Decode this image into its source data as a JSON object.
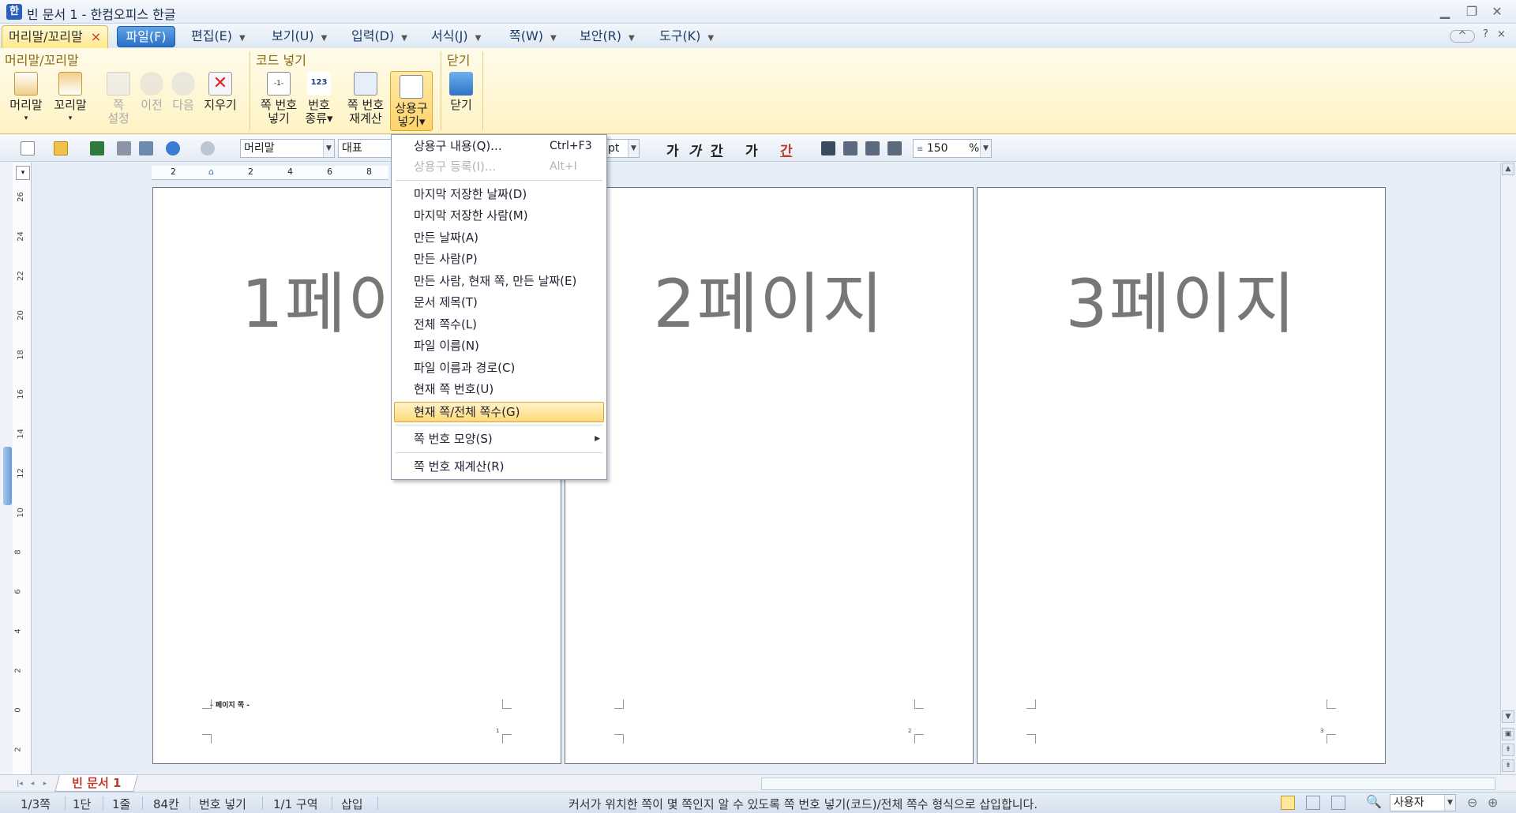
{
  "window": {
    "title": "빈 문서 1 - 한컴오피스 한글",
    "app_icon": "한"
  },
  "menubar": {
    "context_tab": "머리말/꼬리말",
    "context_close": "×",
    "file_tab": "파일(F)",
    "items": [
      "편집(E)",
      "보기(U)",
      "입력(D)",
      "서식(J)",
      "쪽(W)",
      "보안(R)",
      "도구(K)"
    ],
    "right": [
      "^",
      "?",
      "×"
    ]
  },
  "ribbon": {
    "groups": [
      {
        "label": "머리말/꼬리말"
      },
      {
        "label": "코드 넣기"
      },
      {
        "label": "닫기"
      }
    ],
    "buttons": [
      {
        "label": "머리말",
        "sub": "▾"
      },
      {
        "label": "꼬리말",
        "sub": "▾"
      },
      {
        "label": "쪽",
        "sub": "설정"
      },
      {
        "label": "이전"
      },
      {
        "label": "다음"
      },
      {
        "label": "지우기"
      },
      {
        "label": "쪽 번호",
        "sub": "넣기"
      },
      {
        "label": "번호",
        "sub": "종류▾"
      },
      {
        "label": "쪽 번호",
        "sub": "재계산"
      },
      {
        "label": "상용구",
        "sub": "넣기▾"
      },
      {
        "label": "닫기"
      }
    ]
  },
  "toolbar": {
    "style_combo": "머리말",
    "font_combo": "대표",
    "size_unit": "pt",
    "bold": "가",
    "italic": "가",
    "underline": "간",
    "strike": "가",
    "color": "간",
    "line_spacing": "150",
    "percent": "%"
  },
  "pages": [
    {
      "big_text": "1페이지",
      "footer_number": "1",
      "footer_code": "- 페이지 쪽 -"
    },
    {
      "big_text": "2페이지",
      "footer_number": "2"
    },
    {
      "big_text": "3페이지",
      "footer_number": "3"
    }
  ],
  "dropdown": {
    "items": [
      {
        "label": "상용구 내용(Q)...",
        "shortcut": "Ctrl+F3"
      },
      {
        "label": "상용구 등록(I)...",
        "shortcut": "Alt+I",
        "disabled": true
      },
      {
        "label": "마지막 저장한 날짜(D)"
      },
      {
        "label": "마지막 저장한 사람(M)"
      },
      {
        "label": "만든 날짜(A)"
      },
      {
        "label": "만든 사람(P)"
      },
      {
        "label": "만든 사람, 현재 쪽, 만든 날짜(E)"
      },
      {
        "label": "문서 제목(T)"
      },
      {
        "label": "전체 쪽수(L)"
      },
      {
        "label": "파일 이름(N)"
      },
      {
        "label": "파일 이름과 경로(C)"
      },
      {
        "label": "현재 쪽 번호(U)"
      },
      {
        "label": "현재 쪽/전체 쪽수(G)",
        "highlighted": true
      },
      {
        "label": "쪽 번호 모양(S)"
      },
      {
        "label": "쪽 번호 재계산(R)"
      }
    ]
  },
  "sheet": {
    "tab": "빈 문서 1"
  },
  "statusbar": {
    "page": "1/3쪽",
    "column": "1단",
    "line": "1줄",
    "char": "84칸",
    "mode": "번호 넣기",
    "section": "1/1 구역",
    "insert": "삽입",
    "message": "커서가 위치한 쪽이 몇 쪽인지 알 수 있도록 쪽 번호 넣기(코드)/전체 쪽수 형식으로 삽입합니다.",
    "zoom": "사용자"
  },
  "ruler": {
    "vertical_marks": [
      "26",
      "24",
      "22",
      "20",
      "18",
      "16",
      "14",
      "12",
      "10",
      "8",
      "6",
      "4",
      "2",
      "0",
      "2"
    ],
    "horizontal_marks": [
      "2",
      "2",
      "4",
      "6",
      "8"
    ]
  },
  "colors": {
    "ribbon_bg": "#fff3c4",
    "file_tab": "#2a6fc6",
    "highlight": "#ffd978"
  }
}
